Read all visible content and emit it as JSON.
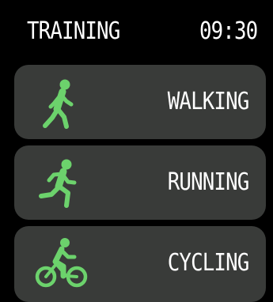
{
  "header": {
    "title": "TRAINING",
    "time": "09:30"
  },
  "activities": [
    {
      "label": "WALKING",
      "icon": "walking-icon"
    },
    {
      "label": "RUNNING",
      "icon": "running-icon"
    },
    {
      "label": "CYCLING",
      "icon": "cycling-icon"
    }
  ],
  "colors": {
    "background": "#000000",
    "card": "#393b39",
    "icon": "#6cd26c",
    "text": "#ffffff"
  }
}
